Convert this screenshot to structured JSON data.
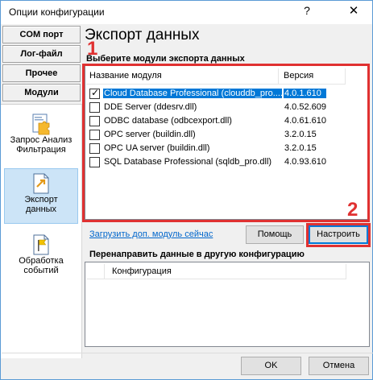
{
  "window": {
    "title": "Опции конфигурации",
    "help_glyph": "?",
    "close_glyph": "✕"
  },
  "nav": {
    "buttons": [
      "COM порт",
      "Лог-файл",
      "Прочее",
      "Модули"
    ],
    "items": [
      {
        "label_line1": "Запрос Анализ",
        "label_line2": "Фильтрация"
      },
      {
        "label_line1": "Экспорт",
        "label_line2": "данных"
      },
      {
        "label_line1": "Обработка",
        "label_line2": "событий"
      }
    ]
  },
  "main": {
    "heading": "Экспорт данных",
    "modules_label": "Выберите модули экспорта данных",
    "columns": {
      "name": "Название модуля",
      "version": "Версия"
    },
    "modules": [
      {
        "name": "Cloud Database Professional (clouddb_pro....",
        "version": "4.0.1.610",
        "checked": true,
        "selected": true
      },
      {
        "name": "DDE Server (ddesrv.dll)",
        "version": "4.0.52.609",
        "checked": false,
        "selected": false
      },
      {
        "name": "ODBC database (odbcexport.dll)",
        "version": "4.0.61.610",
        "checked": false,
        "selected": false
      },
      {
        "name": "OPC server (buildin.dll)",
        "version": "3.2.0.15",
        "checked": false,
        "selected": false
      },
      {
        "name": "OPC UA server (buildin.dll)",
        "version": "3.2.0.15",
        "checked": false,
        "selected": false
      },
      {
        "name": "SQL Database Professional (sqldb_pro.dll)",
        "version": "4.0.93.610",
        "checked": false,
        "selected": false
      }
    ],
    "load_link": "Загрузить доп. модуль сейчас",
    "help_button": "Помощь",
    "setup_button": "Настроить",
    "redirect_label": "Перенаправить данные в другую конфигурацию",
    "redirect_column": "Конфигурация"
  },
  "annotations": {
    "marker1": "1",
    "marker2": "2",
    "color": "#e03131"
  },
  "footer": {
    "ok": "OK",
    "cancel": "Отмена"
  },
  "icons": [
    "help-icon",
    "close-icon",
    "filter-puzzle-icon",
    "export-doc-icon",
    "event-flag-icon",
    "checkbox-icon"
  ]
}
